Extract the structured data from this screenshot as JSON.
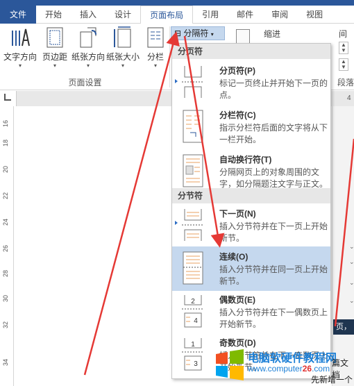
{
  "ribbon_tabs": [
    "文件",
    "开始",
    "插入",
    "设计",
    "页面布局",
    "引用",
    "邮件",
    "审阅",
    "视图"
  ],
  "active_tab": "页面布局",
  "ribbon": {
    "buttons": [
      "文字方向",
      "页边距",
      "纸张方向",
      "纸张大小",
      "分栏"
    ],
    "group_label": "页面设置",
    "breaks_button": "分隔符",
    "indent_label": "缩进",
    "spacing_label_fragment": "间",
    "paragraph_label_fragment": "段落",
    "ruler_number": "4"
  },
  "vertical_ruler_numbers": [
    "16",
    "18",
    "20",
    "22",
    "24",
    "26",
    "28",
    "30",
    "32",
    "34"
  ],
  "menu": {
    "page_breaks_header": "分页符",
    "page_breaks": [
      {
        "title": "分页符(P)",
        "desc": "标记一页终止并开始下一页的点。"
      },
      {
        "title": "分栏符(C)",
        "desc": "指示分栏符后面的文字将从下一栏开始。"
      },
      {
        "title": "自动换行符(T)",
        "desc": "分隔网页上的对象周围的文字，如分隔题注文字与正文。"
      }
    ],
    "section_breaks_header": "分节符",
    "section_breaks": [
      {
        "title": "下一页(N)",
        "desc": "插入分节符并在下一页上开始新节。"
      },
      {
        "title": "连续(O)",
        "desc": "插入分节符并在同一页上开始新节。"
      },
      {
        "title": "偶数页(E)",
        "desc": "插入分节符并在下一偶数页上开始新节。"
      },
      {
        "title": "奇数页(D)",
        "desc": "插入分节符并在下一奇数页上开始新节。"
      }
    ],
    "selected_item": "连续(O)"
  },
  "doc_fragments": {
    "right_dark": "页，",
    "bottom1": "篇文档",
    "bottom2": "先新增一个"
  },
  "watermark": {
    "title": "电脑软硬件教程网",
    "url_prefix": "www.computer",
    "url_highlight": "26",
    "url_suffix": ".com"
  },
  "colors": {
    "brand_blue": "#2b579a",
    "selection": "#c5d8ee",
    "annotation_red": "#e53935"
  }
}
